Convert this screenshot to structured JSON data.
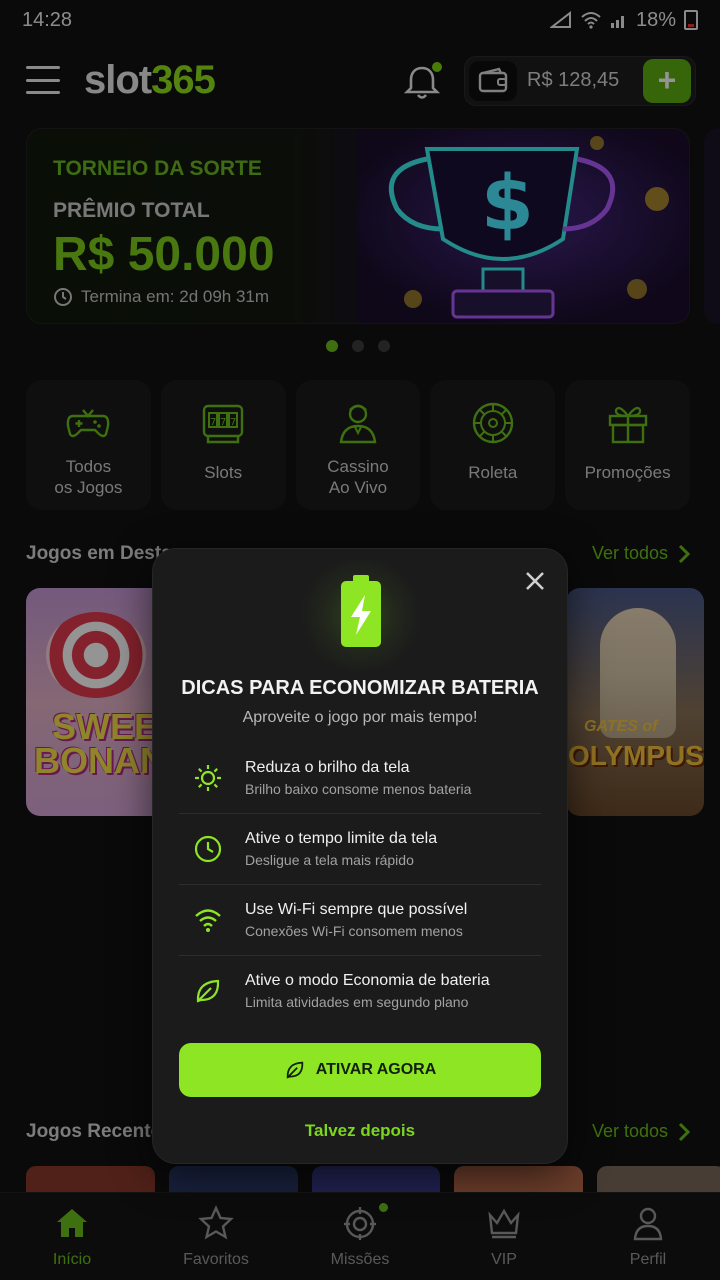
{
  "statusbar": {
    "time": "14:28",
    "battery": "18%"
  },
  "header": {
    "logo_white": "slot",
    "logo_green": "365",
    "balance": "R$ 128,45",
    "add_label": "+"
  },
  "banner": {
    "kicker": "TORNEIO DA SORTE",
    "label": "PRÊMIO TOTAL",
    "amount": "R$ 50.000",
    "ends": "Termina em: 2d 09h 31m",
    "page_count": 3,
    "active_page": 1
  },
  "categories": [
    {
      "line1": "Todos",
      "line2": "os Jogos",
      "icon": "gamepad-icon"
    },
    {
      "line1": "Slots",
      "line2": "",
      "icon": "slot-machine-icon"
    },
    {
      "line1": "Cassino",
      "line2": "Ao Vivo",
      "icon": "dealer-icon"
    },
    {
      "line1": "Roleta",
      "line2": "",
      "icon": "roulette-icon"
    },
    {
      "line1": "Promoções",
      "line2": "",
      "icon": "gift-icon"
    }
  ],
  "featured": {
    "title": "Jogos em Destaque",
    "see_all": "Ver todos",
    "games": [
      {
        "line1": "SWEET",
        "line2": "BONANZA"
      },
      {
        "line1": "GATES of",
        "line2": "OLYMPUS"
      }
    ]
  },
  "recent": {
    "title": "Jogos Recentes",
    "see_all": "Ver todos"
  },
  "modal": {
    "title": "DICAS PARA ECONOMIZAR BATERIA",
    "subtitle": "Aproveite o jogo por mais tempo!",
    "tips": [
      {
        "title": "Reduza o brilho da tela",
        "desc": "Brilho baixo consome menos bateria",
        "icon": "sun-icon"
      },
      {
        "title": "Ative o tempo limite da tela",
        "desc": "Desligue a tela mais rápido",
        "icon": "clock-icon"
      },
      {
        "title": "Use Wi-Fi sempre que possível",
        "desc": "Conexões Wi-Fi consomem menos",
        "icon": "wifi-icon"
      },
      {
        "title": "Ative o modo Economia de bateria",
        "desc": "Limita atividades em segundo plano",
        "icon": "leaf-icon"
      }
    ],
    "cta": "ATIVAR AGORA",
    "later": "Talvez depois"
  },
  "nav": [
    {
      "label": "Início",
      "icon": "home-icon",
      "active": true
    },
    {
      "label": "Favoritos",
      "icon": "star-icon",
      "active": false
    },
    {
      "label": "Missões",
      "icon": "target-icon",
      "active": false
    },
    {
      "label": "VIP",
      "icon": "crown-icon",
      "active": false
    },
    {
      "label": "Perfil",
      "icon": "user-icon",
      "active": false
    }
  ],
  "colors": {
    "accent": "#8ee524",
    "accent_dark": "#6cc21a",
    "bg": "#121212",
    "card": "#1a1a1a",
    "modal": "#1b1b1b"
  }
}
